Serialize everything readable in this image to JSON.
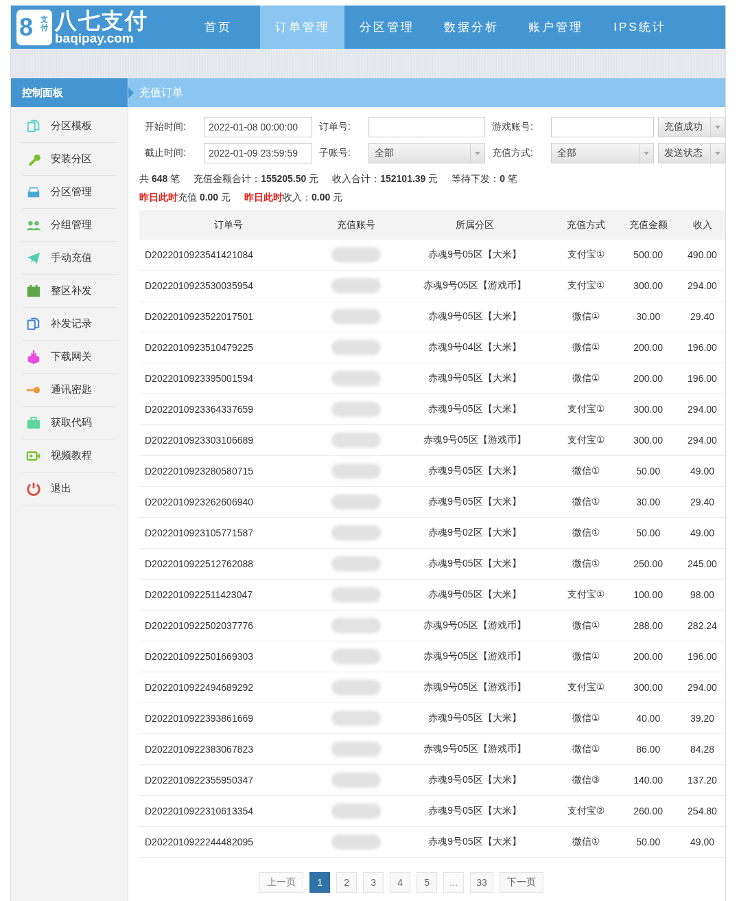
{
  "logo": {
    "mark": "8",
    "mark_small": "支付",
    "name": "八七支付",
    "domain": "baqipay.com"
  },
  "nav": [
    {
      "label": "首页",
      "selected": false
    },
    {
      "label": "订单管理",
      "selected": true
    },
    {
      "label": "分区管理",
      "selected": false
    },
    {
      "label": "数据分析",
      "selected": false
    },
    {
      "label": "账户管理",
      "selected": false
    },
    {
      "label": "IPS统计",
      "selected": false
    }
  ],
  "sidebar": {
    "title": "控制面板",
    "items": [
      "分区模板",
      "安装分区",
      "分区管理",
      "分组管理",
      "手动充值",
      "整区补发",
      "补发记录",
      "下载网关",
      "通讯密匙",
      "获取代码",
      "视频教程",
      "退出"
    ]
  },
  "page_title": "充值订单",
  "filters": {
    "start_label": "开始时间:",
    "start_value": "2022-01-08 00:00:00",
    "end_label": "截止时间:",
    "end_value": "2022-01-09 23:59:59",
    "order_label": "订单号:",
    "sub_label": "子账号:",
    "sub_value": "全部",
    "account_label": "游戏账号:",
    "method_label": "充值方式:",
    "method_value": "全部",
    "status_select": "充值成功",
    "send_select": "发送状态"
  },
  "stats": [
    "共 **648** 笔",
    "充值金额合计：**155205.50** 元",
    "收入合计：**152101.39** 元",
    "等待下发：**0** 笔"
  ],
  "yesterday": [
    {
      "label": "昨日此时",
      "text": "充值 **0.00** 元"
    },
    {
      "label": "昨日此时",
      "text": "收入：**0.00** 元"
    }
  ],
  "table": {
    "columns": [
      "订单号",
      "充值账号",
      "所属分区",
      "充值方式",
      "充值金额",
      "收入"
    ],
    "rows": [
      {
        "order": "D2022010923541421084",
        "account_redacted": true,
        "zone": "赤魂9号05区【大米】",
        "method": "支付宝①",
        "amount": "500.00",
        "income": "490.00"
      },
      {
        "order": "D2022010923530035954",
        "account_redacted": true,
        "zone": "赤魂9号05区【游戏币】",
        "method": "支付宝①",
        "amount": "300.00",
        "income": "294.00"
      },
      {
        "order": "D2022010923522017501",
        "account_redacted": true,
        "zone": "赤魂9号05区【大米】",
        "method": "微信①",
        "amount": "30.00",
        "income": "29.40"
      },
      {
        "order": "D2022010923510479225",
        "account_redacted": true,
        "zone": "赤魂9号04区【大米】",
        "method": "微信①",
        "amount": "200.00",
        "income": "196.00"
      },
      {
        "order": "D2022010923395001594",
        "account_redacted": true,
        "zone": "赤魂9号05区【大米】",
        "method": "微信①",
        "amount": "200.00",
        "income": "196.00"
      },
      {
        "order": "D2022010923364337659",
        "account_redacted": true,
        "zone": "赤魂9号05区【大米】",
        "method": "支付宝①",
        "amount": "300.00",
        "income": "294.00"
      },
      {
        "order": "D2022010923303106689",
        "account_redacted": true,
        "zone": "赤魂9号05区【游戏币】",
        "method": "支付宝①",
        "amount": "300.00",
        "income": "294.00"
      },
      {
        "order": "D2022010923280580715",
        "account_redacted": true,
        "zone": "赤魂9号05区【大米】",
        "method": "微信①",
        "amount": "50.00",
        "income": "49.00"
      },
      {
        "order": "D2022010923262606940",
        "account_redacted": true,
        "zone": "赤魂9号05区【大米】",
        "method": "微信①",
        "amount": "30.00",
        "income": "29.40"
      },
      {
        "order": "D2022010923105771587",
        "account_redacted": true,
        "zone": "赤魂9号02区【大米】",
        "method": "微信①",
        "amount": "50.00",
        "income": "49.00"
      },
      {
        "order": "D2022010922512762088",
        "account_redacted": true,
        "zone": "赤魂9号05区【大米】",
        "method": "微信①",
        "amount": "250.00",
        "income": "245.00"
      },
      {
        "order": "D2022010922511423047",
        "account_redacted": true,
        "zone": "赤魂9号05区【大米】",
        "method": "支付宝①",
        "amount": "100.00",
        "income": "98.00"
      },
      {
        "order": "D2022010922502037776",
        "account_redacted": true,
        "zone": "赤魂9号05区【游戏币】",
        "method": "微信①",
        "amount": "288.00",
        "income": "282.24"
      },
      {
        "order": "D2022010922501669303",
        "account_redacted": true,
        "zone": "赤魂9号05区【游戏币】",
        "method": "微信①",
        "amount": "200.00",
        "income": "196.00"
      },
      {
        "order": "D2022010922494689292",
        "account_redacted": true,
        "zone": "赤魂9号05区【游戏币】",
        "method": "支付宝①",
        "amount": "300.00",
        "income": "294.00"
      },
      {
        "order": "D2022010922393861669",
        "account_redacted": true,
        "zone": "赤魂9号05区【大米】",
        "method": "微信①",
        "amount": "40.00",
        "income": "39.20"
      },
      {
        "order": "D2022010922383067823",
        "account_redacted": true,
        "zone": "赤魂9号05区【游戏币】",
        "method": "微信①",
        "amount": "86.00",
        "income": "84.28"
      },
      {
        "order": "D2022010922355950347",
        "account_redacted": true,
        "zone": "赤魂9号05区【大米】",
        "method": "微信③",
        "amount": "140.00",
        "income": "137.20"
      },
      {
        "order": "D2022010922310613354",
        "account_redacted": true,
        "zone": "赤魂9号05区【大米】",
        "method": "支付宝②",
        "amount": "260.00",
        "income": "254.80"
      },
      {
        "order": "D2022010922244482095",
        "account_redacted": true,
        "zone": "赤魂9号05区【大米】",
        "method": "微信①",
        "amount": "50.00",
        "income": "49.00"
      }
    ]
  },
  "pagination": [
    {
      "label": "上一页",
      "kind": "prev",
      "disabled": true,
      "selected": false
    },
    {
      "label": "1",
      "kind": "page",
      "disabled": false,
      "selected": true
    },
    {
      "label": "2",
      "kind": "page",
      "disabled": false,
      "selected": false
    },
    {
      "label": "3",
      "kind": "page",
      "disabled": false,
      "selected": false
    },
    {
      "label": "4",
      "kind": "page",
      "disabled": false,
      "selected": false
    },
    {
      "label": "5",
      "kind": "page",
      "disabled": false,
      "selected": false
    },
    {
      "label": "...",
      "kind": "gap",
      "disabled": true,
      "selected": false
    },
    {
      "label": "33",
      "kind": "page",
      "disabled": false,
      "selected": false
    },
    {
      "label": "下一页",
      "kind": "next",
      "disabled": false,
      "selected": false
    }
  ]
}
